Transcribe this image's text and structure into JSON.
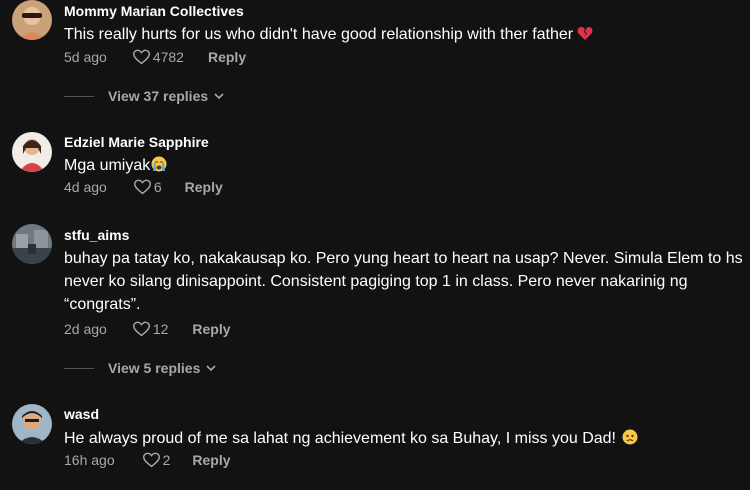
{
  "comments": [
    {
      "username": "Mommy Marian Collectives",
      "text": "This really hurts for us who didn't have good relationship with ther father",
      "emoji": "broken-heart",
      "time": "5d ago",
      "likes": "4782",
      "reply_label": "Reply",
      "view_replies": "View 37 replies"
    },
    {
      "username": "Edziel Marie Sapphire",
      "text": "Mga umiyak",
      "emoji": "crying-face",
      "time": "4d ago",
      "likes": "6",
      "reply_label": "Reply"
    },
    {
      "username": "stfu_aims",
      "text": "buhay pa tatay ko, nakakausap ko. Pero yung heart to heart na usap? Never. Simula Elem to hs never ko silang dinisappoint. Consistent pagiging top 1 in class. Pero never nakarinig ng “congrats”.",
      "time": "2d ago",
      "likes": "12",
      "reply_label": "Reply",
      "view_replies": "View 5 replies"
    },
    {
      "username": "wasd",
      "text": "He always proud of me sa lahat ng achievement ko sa Buhay, I miss you Dad!",
      "emoji": "frowning-face",
      "time": "16h ago",
      "likes": "2",
      "reply_label": "Reply"
    }
  ],
  "colors": {
    "background": "#121212",
    "text_primary": "#ffffff",
    "text_secondary": "#a8a8a8"
  }
}
